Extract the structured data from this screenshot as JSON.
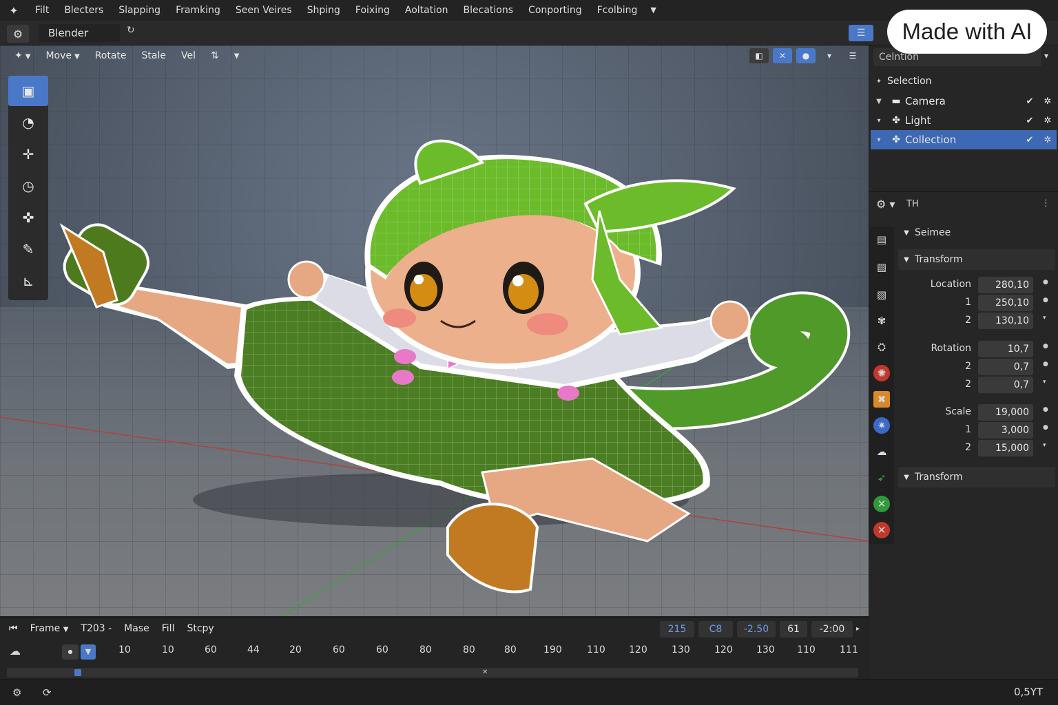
{
  "menubar": {
    "items": [
      "Filt",
      "Blecters",
      "Slapping",
      "Framking",
      "Seen Veires",
      "Shping",
      "Foixing",
      "Aoltation",
      "Blecations",
      "Conporting",
      "Fcolbing"
    ]
  },
  "titlebar": {
    "app_name": "Blender"
  },
  "badge": {
    "text": "Made with AI"
  },
  "viewport_toolbar": {
    "items": [
      "Move",
      "Rotate",
      "Stale",
      "Vel"
    ]
  },
  "outliner": {
    "header": "Celntion",
    "root": "Selection",
    "rows": [
      {
        "label": "Camera",
        "selected": false
      },
      {
        "label": "Light",
        "selected": false
      },
      {
        "label": "Collection",
        "selected": true
      }
    ]
  },
  "properties": {
    "header": "TH",
    "section_top": "Seimee",
    "section_transform": "Transform",
    "section_transform2": "Transform",
    "location": {
      "label": "Location",
      "values": [
        [
          "",
          "280,10"
        ],
        [
          "1",
          "250,10"
        ],
        [
          "2",
          "130,10"
        ]
      ]
    },
    "rotation": {
      "label": "Rotation",
      "values": [
        [
          "",
          "10,7"
        ],
        [
          "2",
          "0,7"
        ],
        [
          "2",
          "0,7"
        ]
      ]
    },
    "scale": {
      "label": "Scale",
      "values": [
        [
          "",
          "19,000"
        ],
        [
          "1",
          "3,000"
        ],
        [
          "2",
          "15,000"
        ]
      ]
    }
  },
  "timeline": {
    "toolbar": [
      "Frame",
      "T203 -",
      "Mase",
      "Fill",
      "Stcpy"
    ],
    "fields": [
      "215",
      "C8",
      "-2.50",
      "61",
      "-2:00"
    ],
    "ruler": [
      "10",
      "10",
      "60",
      "44",
      "20",
      "60",
      "60",
      "80",
      "80",
      "80",
      "190",
      "110",
      "120",
      "130",
      "120",
      "130",
      "110",
      "111"
    ]
  },
  "status": {
    "right": "0,5YT"
  },
  "colors": {
    "accent": "#4a78c8",
    "selected_row": "#3d68b4"
  }
}
